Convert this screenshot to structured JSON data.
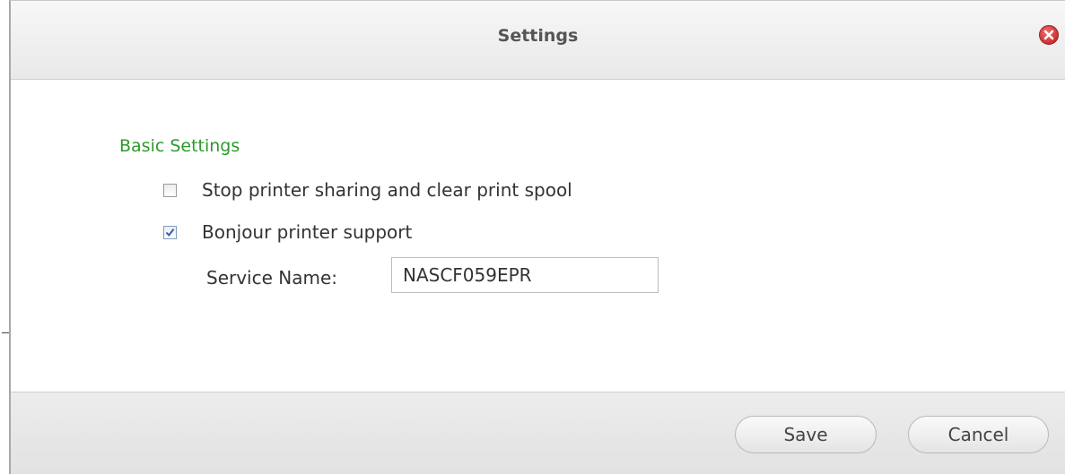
{
  "dialog": {
    "title": "Settings",
    "close_icon": "close-icon",
    "section_title": "Basic Settings",
    "options": [
      {
        "label": "Stop printer sharing and clear print spool",
        "checked": false
      },
      {
        "label": "Bonjour printer support",
        "checked": true
      }
    ],
    "service_name": {
      "label": "Service Name:",
      "value": "NASCF059EPR"
    },
    "buttons": {
      "save": "Save",
      "cancel": "Cancel"
    }
  },
  "colors": {
    "section_title": "#2c9a2c",
    "close_icon": "#d43b3b",
    "checkmark": "#3a5fa8"
  }
}
